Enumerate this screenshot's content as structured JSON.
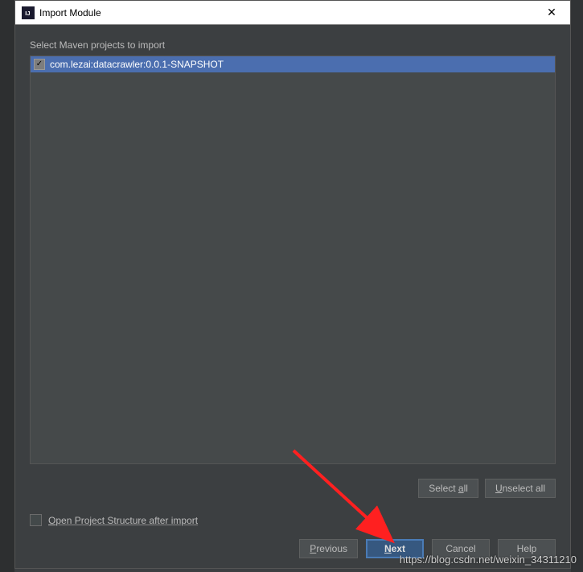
{
  "titlebar": {
    "title": "Import Module"
  },
  "section": {
    "label": "Select Maven projects to import"
  },
  "projects": [
    {
      "label": "com.lezai:datacrawler:0.0.1-SNAPSHOT",
      "checked": true
    }
  ],
  "buttons": {
    "select_all": "Select all",
    "unselect_all": "Unselect all",
    "previous": "Previous",
    "next": "Next",
    "cancel": "Cancel",
    "help": "Help"
  },
  "openStructure": {
    "label": "Open Project Structure after import"
  },
  "watermark": "https://blog.csdn.net/weixin_34311210"
}
